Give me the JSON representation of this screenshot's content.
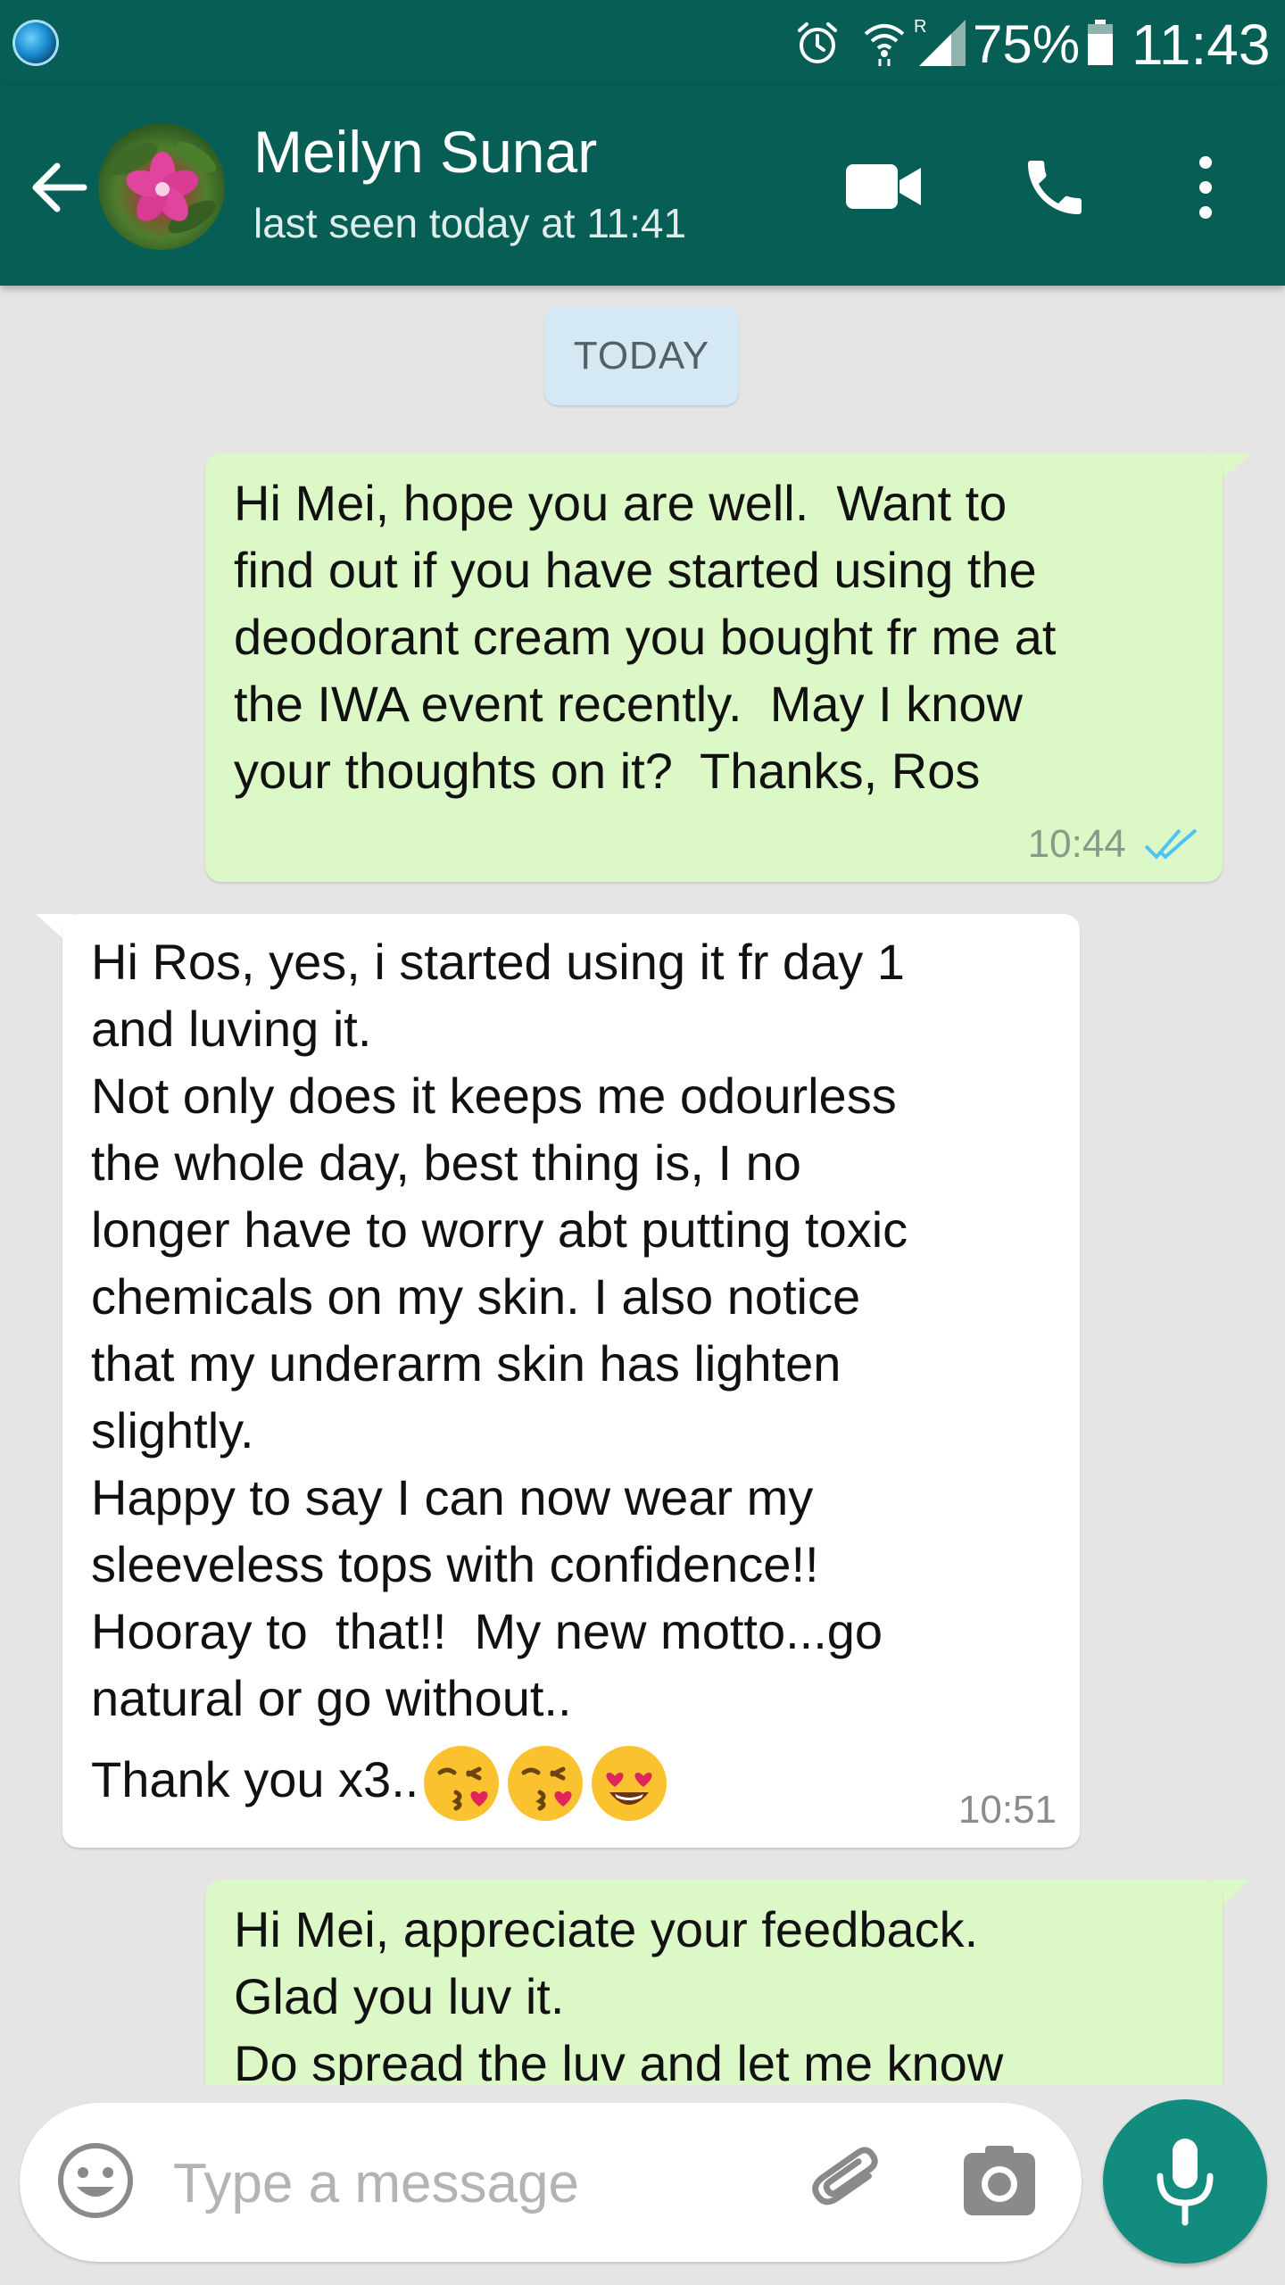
{
  "status_bar": {
    "battery_percent": "75%",
    "time": "11:43",
    "icons": [
      "app-notification-icon",
      "alarm-icon",
      "wifi-icon",
      "signal-icon",
      "battery-icon"
    ]
  },
  "header": {
    "contact_name": "Meilyn Sunar",
    "last_seen": "last seen today at 11:41",
    "icons": [
      "back-arrow-icon",
      "video-call-icon",
      "phone-icon",
      "more-vert-icon"
    ]
  },
  "chat": {
    "date_separator": "TODAY",
    "messages": [
      {
        "direction": "outgoing",
        "text": "Hi Mei, hope you are well.  Want to\nfind out if you have started using the\ndeodorant cream you bought fr me at\nthe IWA event recently.  May I know\nyour thoughts on it?  Thanks, Ros",
        "time": "10:44",
        "status": "read"
      },
      {
        "direction": "incoming",
        "text": "Hi Ros, yes, i started using it fr day 1\nand luving it.\nNot only does it keeps me odourless\nthe whole day, best thing is, I no\nlonger have to worry abt putting toxic\nchemicals on my skin. I also notice\nthat my underarm skin has lighten\nslightly.\nHappy to say I can now wear my\nsleeveless tops with confidence!!\nHooray to  that!!  My new motto...go\nnatural or go without..",
        "last_line": "Thank you x3..",
        "emojis": [
          "face-blowing-kiss",
          "face-blowing-kiss",
          "smiling-face-with-heart-eyes"
        ],
        "time": "10:51"
      },
      {
        "direction": "outgoing",
        "text": "Hi Mei, appreciate your feedback.\nGlad you luv it.\nDo spread the luv and let me know"
      }
    ]
  },
  "composer": {
    "placeholder": "Type a message",
    "icons": [
      "emoji-icon",
      "attach-icon",
      "camera-icon",
      "mic-icon"
    ]
  },
  "colors": {
    "header_bg": "#075e54",
    "chat_bg": "#e5e5e5",
    "outgoing_bubble": "#dcf8c6",
    "incoming_bubble": "#ffffff",
    "mic_button": "#128c7e",
    "read_tick": "#4fc3f7"
  }
}
